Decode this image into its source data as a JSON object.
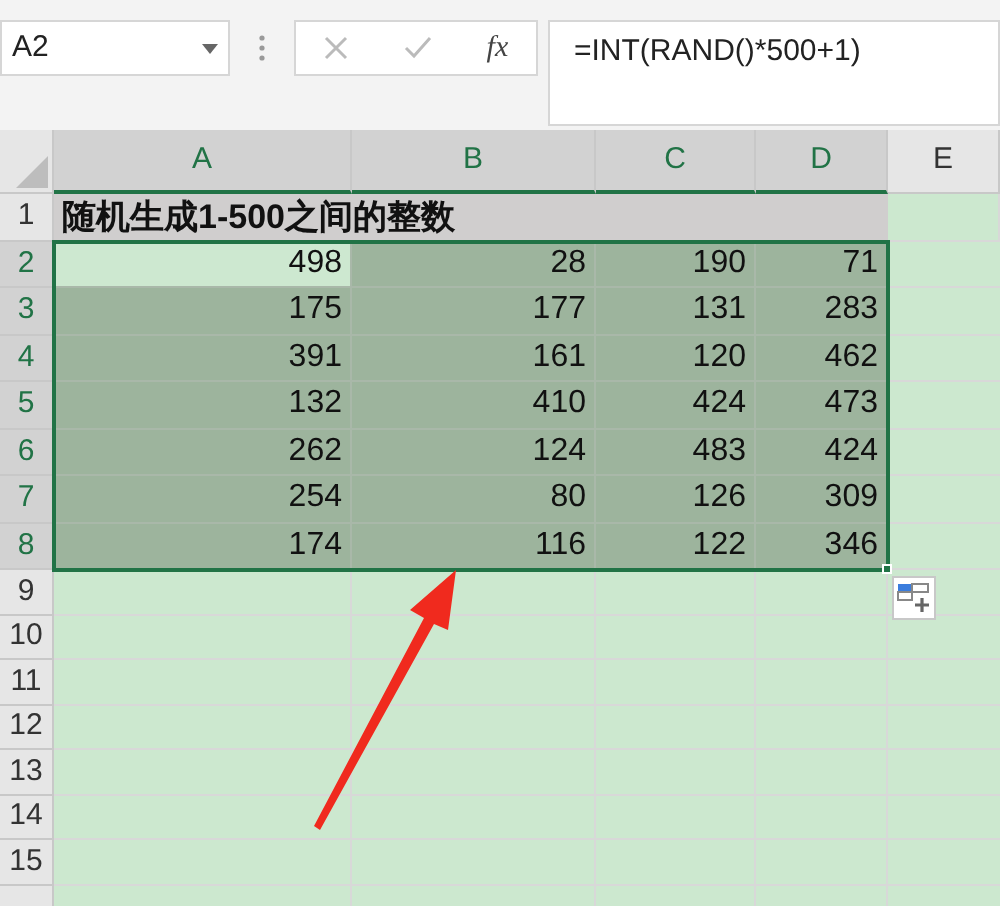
{
  "name_box": {
    "value": "A2"
  },
  "formula_bar": {
    "fx_label": "fx",
    "formula": "=INT(RAND()*500+1)"
  },
  "columns": [
    {
      "label": "A",
      "selected": true
    },
    {
      "label": "B",
      "selected": true
    },
    {
      "label": "C",
      "selected": true
    },
    {
      "label": "D",
      "selected": true
    },
    {
      "label": "E",
      "selected": false
    }
  ],
  "title_row": {
    "number": "1",
    "text": "随机生成1-500之间的整数"
  },
  "data_rows": [
    {
      "number": "2",
      "selected": true,
      "cells": [
        {
          "value": "498",
          "active": true
        },
        {
          "value": "28",
          "active": false
        },
        {
          "value": "190",
          "active": false
        },
        {
          "value": "71",
          "active": false
        }
      ]
    },
    {
      "number": "3",
      "selected": true,
      "cells": [
        {
          "value": "175",
          "active": false
        },
        {
          "value": "177",
          "active": false
        },
        {
          "value": "131",
          "active": false
        },
        {
          "value": "283",
          "active": false
        }
      ]
    },
    {
      "number": "4",
      "selected": true,
      "cells": [
        {
          "value": "391",
          "active": false
        },
        {
          "value": "161",
          "active": false
        },
        {
          "value": "120",
          "active": false
        },
        {
          "value": "462",
          "active": false
        }
      ]
    },
    {
      "number": "5",
      "selected": true,
      "cells": [
        {
          "value": "132",
          "active": false
        },
        {
          "value": "410",
          "active": false
        },
        {
          "value": "424",
          "active": false
        },
        {
          "value": "473",
          "active": false
        }
      ]
    },
    {
      "number": "6",
      "selected": true,
      "cells": [
        {
          "value": "262",
          "active": false
        },
        {
          "value": "124",
          "active": false
        },
        {
          "value": "483",
          "active": false
        },
        {
          "value": "424",
          "active": false
        }
      ]
    },
    {
      "number": "7",
      "selected": true,
      "cells": [
        {
          "value": "254",
          "active": false
        },
        {
          "value": "80",
          "active": false
        },
        {
          "value": "126",
          "active": false
        },
        {
          "value": "309",
          "active": false
        }
      ]
    },
    {
      "number": "8",
      "selected": true,
      "cells": [
        {
          "value": "174",
          "active": false
        },
        {
          "value": "116",
          "active": false
        },
        {
          "value": "122",
          "active": false
        },
        {
          "value": "346",
          "active": false
        }
      ]
    },
    {
      "number": "9",
      "selected": false,
      "cells": []
    },
    {
      "number": "10",
      "selected": false,
      "cells": []
    },
    {
      "number": "11",
      "selected": false,
      "cells": []
    },
    {
      "number": "12",
      "selected": false,
      "cells": []
    },
    {
      "number": "13",
      "selected": false,
      "cells": []
    },
    {
      "number": "14",
      "selected": false,
      "cells": []
    },
    {
      "number": "15",
      "selected": false,
      "cells": []
    }
  ]
}
